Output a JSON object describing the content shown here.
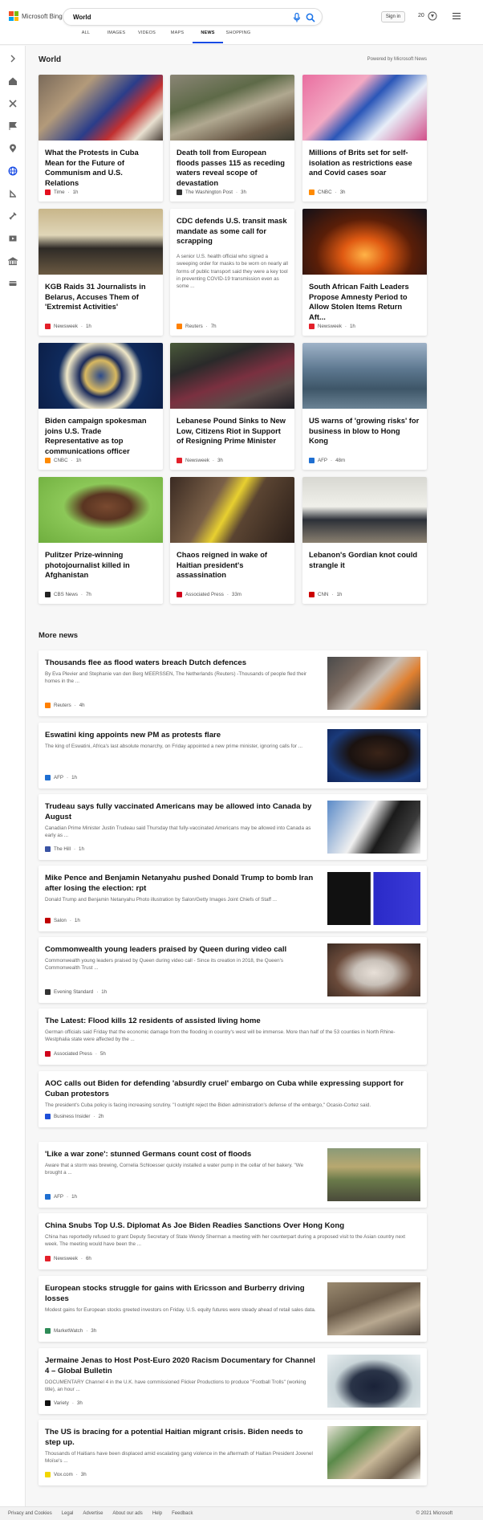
{
  "header": {
    "logo_text": "Microsoft Bing",
    "search_query": "World",
    "signin_label": "Sign in",
    "points": "20",
    "tabs": [
      "ALL",
      "IMAGES",
      "VIDEOS",
      "MAPS",
      "NEWS",
      "SHOPPING"
    ],
    "active_tab": "NEWS"
  },
  "colors": {
    "accent": "#174ae4",
    "ms_red": "#f25022",
    "ms_green": "#7fba00",
    "ms_blue": "#00a4ef",
    "ms_yellow": "#ffb900"
  },
  "sidebar": {
    "icons": [
      "expand-icon",
      "home-icon",
      "sports-icon",
      "flag-icon",
      "location-icon",
      "globe-icon",
      "politics-icon",
      "science-icon",
      "entertainment-icon",
      "money-icon",
      "lifestyle-icon"
    ]
  },
  "section": {
    "title": "World",
    "powered_by": "Powered by Microsoft News"
  },
  "cards": [
    {
      "title": "What the Protests in Cuba Mean for the Future of Communism and U.S. Relations",
      "source": "Time",
      "time": "1h",
      "src_color": "#e4101f",
      "image": "protest-photo"
    },
    {
      "title": "Death toll from European floods passes 115 as receding waters reveal scope of devastation",
      "source": "The Washington Post",
      "time": "3h",
      "src_color": "#333333",
      "image": "flood-debris-photo"
    },
    {
      "title": "Millions of Brits set for self-isolation as restrictions ease and Covid cases soar",
      "source": "CNBC",
      "time": "3h",
      "src_color": "#ff8a00",
      "image": "nhs-app-photo"
    },
    {
      "title": "KGB Raids 31 Journalists in Belarus, Accuses Them of 'Extremist Activities'",
      "source": "Newsweek",
      "time": "1h",
      "src_color": "#e3202a",
      "image": "leaders-meeting-photo"
    },
    {
      "title": "CDC defends U.S. transit mask mandate as some call for scrapping",
      "snippet": "A senior U.S. health official who signed a sweeping order for masks to be worn on nearly all forms of public transport said they were a key tool in preventing COVID-19 transmission even as some ...",
      "source": "Reuters",
      "time": "7h",
      "src_color": "#ff8000",
      "image": ""
    },
    {
      "title": "South African Faith Leaders Propose Amnesty Period to Allow Stolen Items Return Aft...",
      "source": "Newsweek",
      "time": "1h",
      "src_color": "#e3202a",
      "image": "fire-night-photo"
    },
    {
      "title": "Biden campaign spokesman joins U.S. Trade Representative as top communications officer",
      "source": "CNBC",
      "time": "1h",
      "src_color": "#ff8a00",
      "image": "ustr-seal-photo"
    },
    {
      "title": "Lebanese Pound Sinks to New Low, Citizens Riot in Support of Resigning Prime Minister",
      "source": "Newsweek",
      "time": "3h",
      "src_color": "#e3202a",
      "image": "riot-photo"
    },
    {
      "title": "US warns of 'growing risks' for business in blow to Hong Kong",
      "source": "AFP",
      "time": "48m",
      "src_color": "#1f6fd1",
      "image": "hongkong-photo"
    },
    {
      "title": "Pulitzer Prize-winning photojournalist killed in Afghanistan",
      "source": "CBS News",
      "time": "7h",
      "src_color": "#222222",
      "image": "portrait-photo"
    },
    {
      "title": "Chaos reigned in wake of Haitian president's assassination",
      "source": "Associated Press",
      "time": "33m",
      "src_color": "#d0021b",
      "image": "haiti-tape-photo"
    },
    {
      "title": "Lebanon's Gordian knot could strangle it",
      "source": "CNN",
      "time": "1h",
      "src_color": "#cc0000",
      "image": "office-meeting-photo"
    }
  ],
  "more": {
    "title": "More news",
    "items": [
      {
        "title": "Thousands flee as flood waters breach Dutch defences",
        "snippet": "By Eva Plevier and Stephanie van den Berg MEERSSEN, The Netherlands (Reuters) -Thousands of people fled their homes in the ...",
        "source": "Reuters",
        "time": "4h",
        "src_color": "#ff8000",
        "image": "dutch-flood-photo"
      },
      {
        "title": "Eswatini king appoints new PM as protests flare",
        "snippet": "The king of Eswatini, Africa's last absolute monarchy, on Friday appointed a new prime minister, ignoring calls for ...",
        "source": "AFP",
        "time": "1h",
        "src_color": "#1f6fd1",
        "image": "eswatini-photo"
      },
      {
        "title": "Trudeau says fully vaccinated Americans may be allowed into Canada by August",
        "snippet": "Canadian Prime Minister Justin Trudeau said Thursday that fully-vaccinated Americans may be allowed into Canada as early as ...",
        "source": "The Hill",
        "time": "1h",
        "src_color": "#3a53a4",
        "image": "trudeau-photo"
      },
      {
        "title": "Mike Pence and Benjamin Netanyahu pushed Donald Trump to bomb Iran after losing the election: rpt",
        "snippet": "Donald Trump and Benjamin Netanyahu Photo illustration by Salon/Getty Images Joint Chiefs of Staff ...",
        "source": "Salon",
        "time": "1h",
        "src_color": "#c00000",
        "image": "trump-netanyahu-photo"
      },
      {
        "title": "Commonwealth young leaders praised by Queen during video call",
        "snippet": "Commonwealth young leaders praised by Queen during video call - Since its creation in 2018, the Queen's Commonwealth Trust ...",
        "source": "Evening Standard",
        "time": "1h",
        "src_color": "#333333",
        "image": "queen-photo"
      },
      {
        "title": "The Latest: Flood kills 12 residents of assisted living home",
        "snippet": "German officials said Friday that the economic damage from the flooding in country's west will be immense. More than half of the 53 counties in North Rhine-Westphalia state were affected by the ...",
        "source": "Associated Press",
        "time": "5h",
        "src_color": "#d0021b",
        "image": ""
      },
      {
        "title": "AOC calls out Biden for defending 'absurdly cruel' embargo on Cuba while expressing support for Cuban protestors",
        "snippet": "The president's Cuba policy is facing increasing scrutiny. \"I outright reject the Biden administration's defense of the embargo,\" Ocasio-Cortez said.",
        "source": "Business Insider",
        "time": "2h",
        "src_color": "#1e4fd8",
        "image": ""
      },
      {
        "title": "'Like a war zone': stunned Germans count cost of floods",
        "snippet": "Aware that a storm was brewing, Cornelia Schloesser quickly installed a water pump in the cellar of her bakery. \"We brought a ...",
        "source": "AFP",
        "time": "1h",
        "src_color": "#1f6fd1",
        "image": "german-street-photo"
      },
      {
        "title": "China Snubs Top U.S. Diplomat As Joe Biden Readies Sanctions Over Hong Kong",
        "snippet": "China has reportedly refused to grant Deputy Secretary of State Wendy Sherman a meeting with her counterpart during a proposed visit to the Asian country next week. The meeting would have been the ...",
        "source": "Newsweek",
        "time": "6h",
        "src_color": "#e3202a",
        "image": ""
      },
      {
        "title": "European stocks struggle for gains with Ericsson and Burberry driving losses",
        "snippet": "Modest gains for European stocks greeted investors on Friday. U.S. equity futures were steady ahead of retail sales data.",
        "source": "MarketWatch",
        "time": "3h",
        "src_color": "#2e8b57",
        "image": "rubble-photo"
      },
      {
        "title": "Jermaine Jenas to Host Post-Euro 2020 Racism Documentary for Channel 4 – Global Bulletin",
        "snippet": "DOCUMENTARY Channel 4 in the U.K. have commissioned Flicker Productions to produce \"Football Trolls\" (working title), an hour ...",
        "source": "Variety",
        "time": "3h",
        "src_color": "#111111",
        "image": "jenas-photo"
      },
      {
        "title": "The US is bracing for a potential Haitian migrant crisis. Biden needs to step up.",
        "snippet": "Thousands of Haitians have been displaced amid escalating gang violence in the aftermath of Haitian President Jovenel Moïse's ...",
        "source": "Vox.com",
        "time": "3h",
        "src_color": "#f2d600",
        "image": "haiti-crowd-photo"
      }
    ]
  },
  "footer": {
    "links": [
      "Privacy and Cookies",
      "Legal",
      "Advertise",
      "About our ads",
      "Help",
      "Feedback"
    ],
    "copyright": "© 2021 Microsoft"
  }
}
